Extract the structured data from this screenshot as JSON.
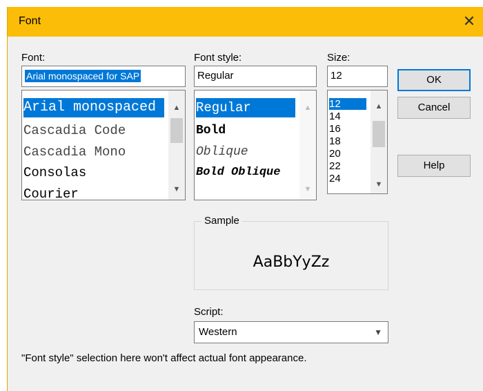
{
  "window": {
    "title": "Font",
    "close_glyph": "✕"
  },
  "font": {
    "label": "Font:",
    "value": "Arial monospaced for SAP",
    "items": [
      "Arial monospaced for SAP",
      "Cascadia Code",
      "Cascadia Mono",
      "Consolas",
      "Courier"
    ],
    "selected_index": 0
  },
  "style": {
    "label": "Font style:",
    "value": "Regular",
    "items": [
      "Regular",
      "Bold",
      "Oblique",
      "Bold Oblique"
    ],
    "selected_index": 0
  },
  "size": {
    "label": "Size:",
    "value": "12",
    "items": [
      "12",
      "14",
      "16",
      "18",
      "20",
      "22",
      "24"
    ],
    "selected_index": 0
  },
  "buttons": {
    "ok": "OK",
    "cancel": "Cancel",
    "help": "Help"
  },
  "sample": {
    "label": "Sample",
    "text": "AaBbYyZz"
  },
  "script": {
    "label": "Script:",
    "value": "Western"
  },
  "note": "\"Font style\" selection here won't affect actual font appearance.",
  "icons": {
    "up": "chevron-up-icon",
    "down": "chevron-down-icon"
  },
  "colors": {
    "titlebar": "#fbbd08",
    "selection": "#0078d7",
    "dialog_bg": "#f0f0f0"
  }
}
